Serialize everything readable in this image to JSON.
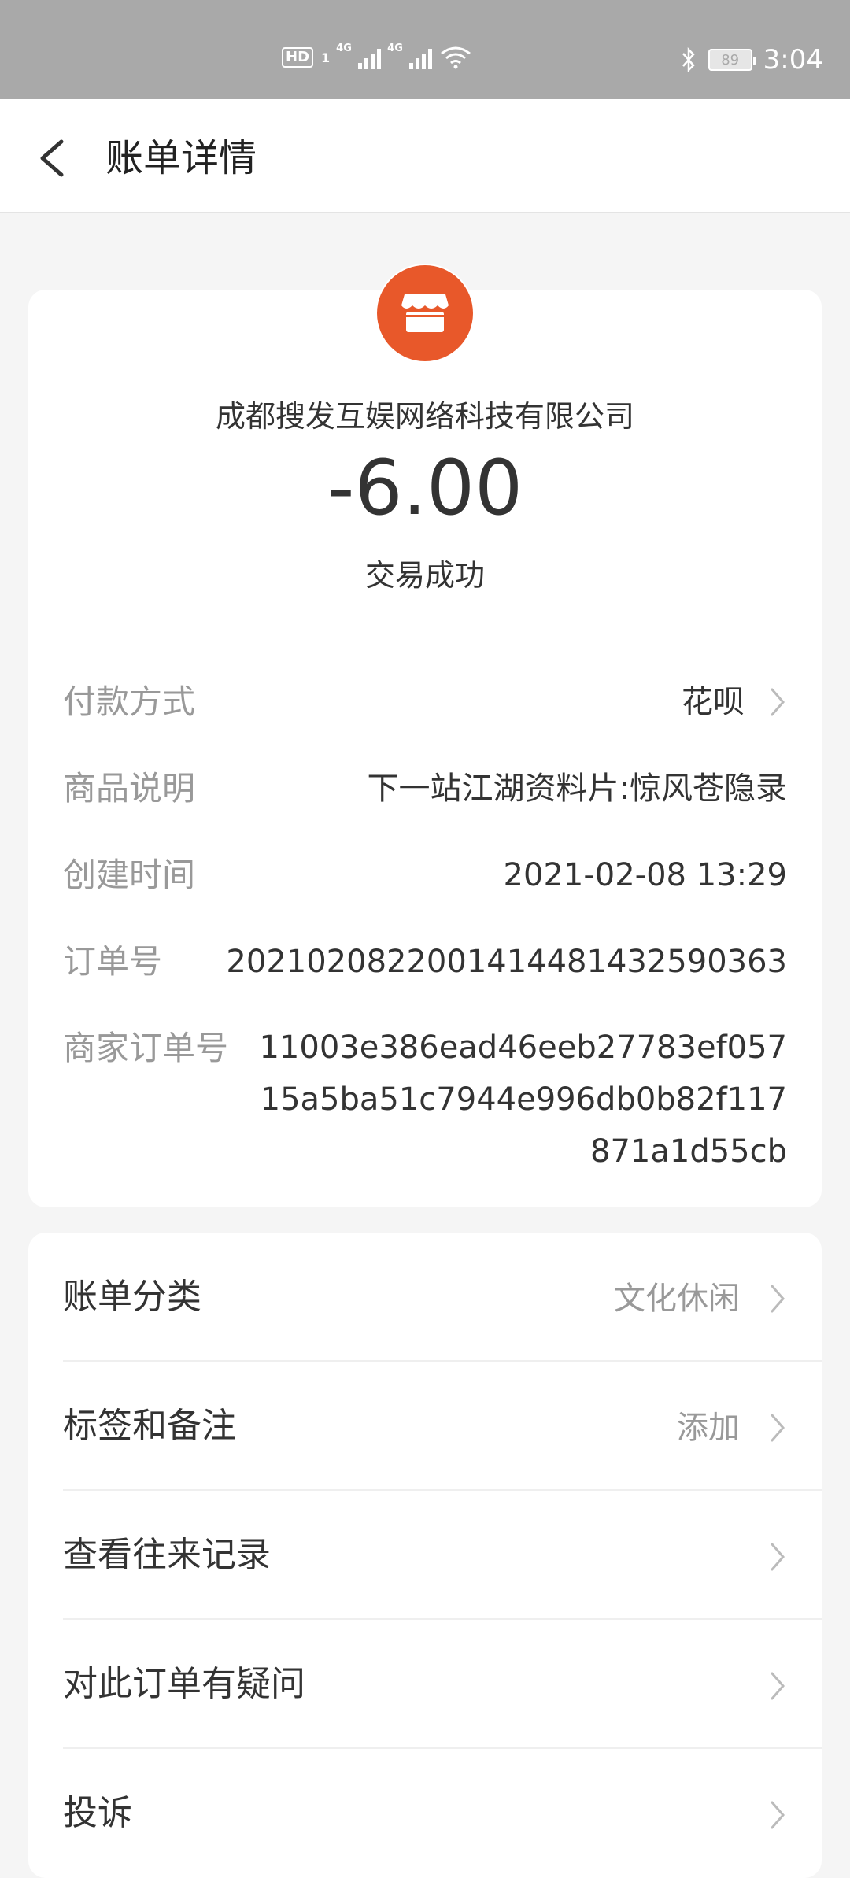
{
  "status_bar": {
    "hd": "HD",
    "sim": "1",
    "net1": "4G",
    "net2": "4G",
    "battery": "89",
    "time": "3:04"
  },
  "header": {
    "title": "账单详情"
  },
  "summary": {
    "merchant": "成都搜发互娱网络科技有限公司",
    "amount": "-6.00",
    "status": "交易成功",
    "logo_color": "#e8582a"
  },
  "details": [
    {
      "label": "付款方式",
      "value": "花呗"
    },
    {
      "label": "商品说明",
      "value": "下一站江湖资料片:惊风苍隐录"
    },
    {
      "label": "创建时间",
      "value": "2021-02-08 13:29"
    },
    {
      "label": "订单号",
      "value": "2021020822001414481432590363"
    },
    {
      "label": "商家订单号",
      "lines": [
        "11003e386ead46eeb27783ef057",
        "15a5ba51c7944e996db0b82f117",
        "871a1d55cb"
      ]
    }
  ],
  "menu": [
    {
      "label": "账单分类",
      "value": "文化休闲"
    },
    {
      "label": "标签和备注",
      "value": "添加"
    },
    {
      "label": "查看往来记录",
      "value": ""
    },
    {
      "label": "对此订单有疑问",
      "value": ""
    },
    {
      "label": "投诉",
      "value": ""
    }
  ]
}
